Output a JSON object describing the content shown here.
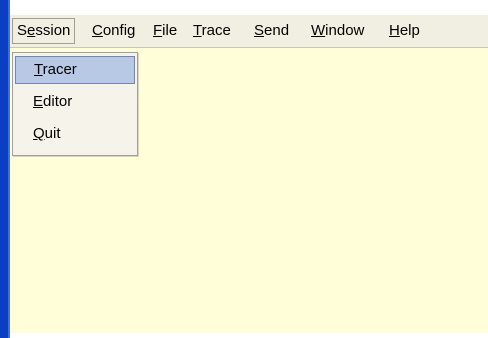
{
  "menubar": {
    "items": [
      {
        "prefix": "S",
        "mnemonic": "e",
        "suffix": "ssion"
      },
      {
        "prefix": "",
        "mnemonic": "C",
        "suffix": "onfig"
      },
      {
        "prefix": "",
        "mnemonic": "F",
        "suffix": "ile"
      },
      {
        "prefix": "",
        "mnemonic": "T",
        "suffix": "race"
      },
      {
        "prefix": "",
        "mnemonic": "S",
        "suffix": "end"
      },
      {
        "prefix": "",
        "mnemonic": "W",
        "suffix": "indow"
      },
      {
        "prefix": "",
        "mnemonic": "H",
        "suffix": "elp"
      }
    ],
    "active_item": "Session"
  },
  "session_menu": {
    "items": [
      {
        "mnemonic": "T",
        "suffix": "racer",
        "highlighted": true
      },
      {
        "mnemonic": "E",
        "suffix": "ditor",
        "highlighted": false
      },
      {
        "mnemonic": "Q",
        "suffix": "uit",
        "highlighted": false
      }
    ]
  },
  "colors": {
    "frame": "#0a3fc4",
    "menubar_bg": "#f1efe2",
    "client_bg": "#fffed8",
    "menu_highlight": "#b8c9e6"
  }
}
